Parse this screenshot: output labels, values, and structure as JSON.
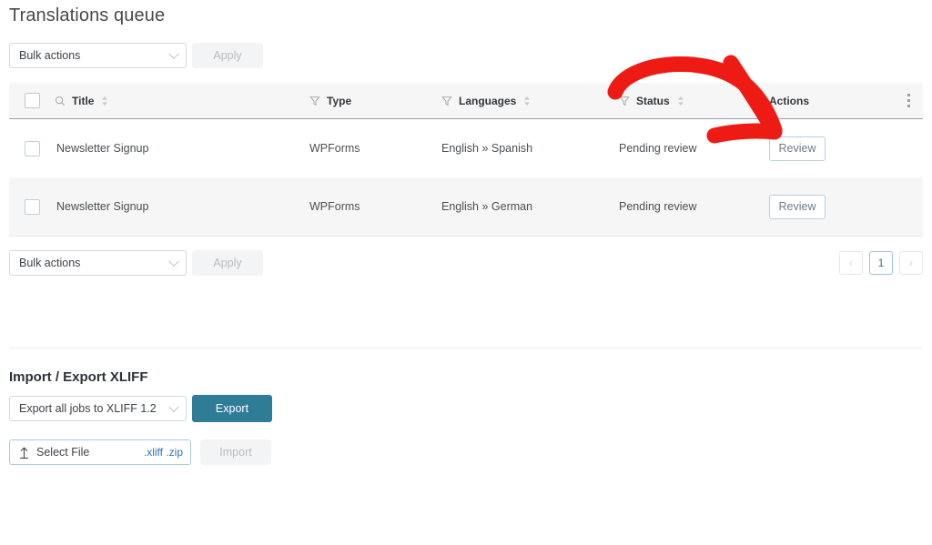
{
  "page": {
    "title": "Translations queue"
  },
  "top_toolbar": {
    "bulk_select_value": "Bulk actions",
    "apply_label": "Apply",
    "chevron_icon": "chevron-down-icon"
  },
  "table": {
    "columns": [
      {
        "key": "checkbox",
        "label": "",
        "icon": "checkbox-icon",
        "filter": false,
        "sortable": false
      },
      {
        "key": "title",
        "label": "Title",
        "icon": "search-icon",
        "filter": false,
        "sortable": true
      },
      {
        "key": "type",
        "label": "Type",
        "icon": "filter-icon",
        "filter": true,
        "sortable": false
      },
      {
        "key": "languages",
        "label": "Languages",
        "icon": "filter-icon",
        "filter": true,
        "sortable": true
      },
      {
        "key": "status",
        "label": "Status",
        "icon": "filter-icon",
        "filter": true,
        "sortable": true
      },
      {
        "key": "actions",
        "label": "Actions",
        "icon": "",
        "filter": false,
        "sortable": false
      },
      {
        "key": "more",
        "label": "",
        "icon": "more-vertical-icon",
        "filter": false,
        "sortable": false
      }
    ],
    "rows": [
      {
        "title": "Newsletter Signup",
        "type": "WPForms",
        "languages": "English » Spanish",
        "status": "Pending review",
        "action_label": "Review"
      },
      {
        "title": "Newsletter Signup",
        "type": "WPForms",
        "languages": "English » German",
        "status": "Pending review",
        "action_label": "Review"
      }
    ]
  },
  "bottom_toolbar": {
    "bulk_select_value": "Bulk actions",
    "apply_label": "Apply"
  },
  "pagination": {
    "prev_label": "‹",
    "current_page": "1",
    "next_label": "›"
  },
  "import_export": {
    "section_title": "Import / Export XLIFF",
    "export_select_value": "Export all jobs to XLIFF 1.2",
    "export_button_label": "Export",
    "select_file_label": "Select File",
    "accepted_extensions": ".xliff .zip",
    "import_button_label": "Import",
    "upload_icon": "upload-arrow-icon"
  },
  "annotation": {
    "type": "curved-arrow",
    "color": "#ee1b15",
    "points_to": "Review"
  },
  "colors": {
    "primary_button": "#2f7c96",
    "header_background": "#f6f6f6",
    "alt_row_background": "#f6f6f6",
    "review_border": "#b9cfe0",
    "annotation_red": "#ee1b15"
  }
}
